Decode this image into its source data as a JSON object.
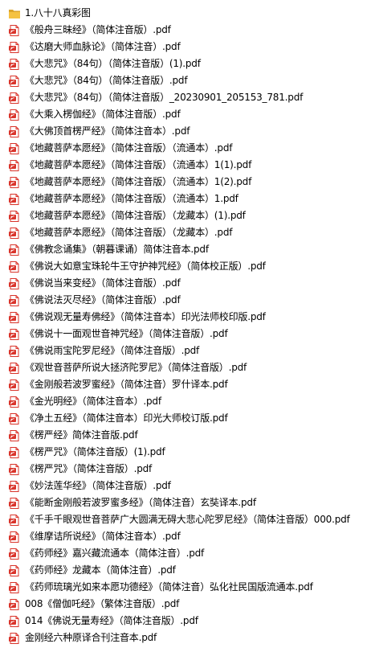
{
  "colors": {
    "pdf_icon_red": "#d9342b",
    "folder_yellow": "#f5c242",
    "folder_dark": "#dca52b",
    "text": "#000000",
    "background": "#ffffff"
  },
  "files": [
    {
      "name": "1.八十八真彩图",
      "icon": "folder-icon"
    },
    {
      "name": "《般舟三昧经》（简体注音版）.pdf",
      "icon": "pdf-icon"
    },
    {
      "name": "《达磨大师血脉论》（简体注音）.pdf",
      "icon": "pdf-icon"
    },
    {
      "name": "《大悲咒》（84句）（简体注音版）(1).pdf",
      "icon": "pdf-icon"
    },
    {
      "name": "《大悲咒》（84句）（简体注音版）.pdf",
      "icon": "pdf-icon"
    },
    {
      "name": "《大悲咒》（84句）（简体注音版）_20230901_205153_781.pdf",
      "icon": "pdf-icon"
    },
    {
      "name": "《大乘入楞伽经》（简体注音版）.pdf",
      "icon": "pdf-icon"
    },
    {
      "name": "《大佛顶首楞严经》（简体注音本）.pdf",
      "icon": "pdf-icon"
    },
    {
      "name": "《地藏菩萨本愿经》（简体注音版）（流通本）.pdf",
      "icon": "pdf-icon"
    },
    {
      "name": "《地藏菩萨本愿经》（简体注音版）（流通本）1(1).pdf",
      "icon": "pdf-icon"
    },
    {
      "name": "《地藏菩萨本愿经》（简体注音版）（流通本）1(2).pdf",
      "icon": "pdf-icon"
    },
    {
      "name": "《地藏菩萨本愿经》（简体注音版）（流通本）1.pdf",
      "icon": "pdf-icon"
    },
    {
      "name": "《地藏菩萨本愿经》（简体注音版）（龙藏本）(1).pdf",
      "icon": "pdf-icon"
    },
    {
      "name": "《地藏菩萨本愿经》（简体注音版）（龙藏本）.pdf",
      "icon": "pdf-icon"
    },
    {
      "name": "《佛教念诵集》（朝暮课诵）简体注音本.pdf",
      "icon": "pdf-icon"
    },
    {
      "name": "《佛说大如意宝珠轮牛王守护神咒经》（简体校正版）.pdf",
      "icon": "pdf-icon"
    },
    {
      "name": "《佛说当来变经》（简体注音版）.pdf",
      "icon": "pdf-icon"
    },
    {
      "name": "《佛说法灭尽经》（简体注音版）.pdf",
      "icon": "pdf-icon"
    },
    {
      "name": "《佛说观无量寿佛经》（简体注音本）印光法师校印版.pdf",
      "icon": "pdf-icon"
    },
    {
      "name": "《佛说十一面观世音神咒经》（简体注音版）.pdf",
      "icon": "pdf-icon"
    },
    {
      "name": "《佛说雨宝陀罗尼经》（简体注音版）.pdf",
      "icon": "pdf-icon"
    },
    {
      "name": "《观世音菩萨所说大拯济陀罗尼》（简体注音版）.pdf",
      "icon": "pdf-icon"
    },
    {
      "name": "《金刚般若波罗蜜经》（简体注音）罗什译本.pdf",
      "icon": "pdf-icon"
    },
    {
      "name": "《金光明经》（简体注音本）.pdf",
      "icon": "pdf-icon"
    },
    {
      "name": "《净土五经》（简体注音本）印光大师校订版.pdf",
      "icon": "pdf-icon"
    },
    {
      "name": "《楞严经》简体注音版.pdf",
      "icon": "pdf-icon"
    },
    {
      "name": "《楞严咒》（简体注音版）(1).pdf",
      "icon": "pdf-icon"
    },
    {
      "name": "《楞严咒》（简体注音版）.pdf",
      "icon": "pdf-icon"
    },
    {
      "name": "《妙法莲华经》（简体注音版）.pdf",
      "icon": "pdf-icon"
    },
    {
      "name": "《能断金刚般若波罗蜜多经》（简体注音）玄奘译本.pdf",
      "icon": "pdf-icon"
    },
    {
      "name": "《千手千眼观世音菩萨广大圆满无碍大悲心陀罗尼经》（简体注音版）000.pdf",
      "icon": "pdf-icon"
    },
    {
      "name": "《维摩诘所说经》（简体注音本）.pdf",
      "icon": "pdf-icon"
    },
    {
      "name": "《药师经》嘉兴藏流通本（简体注音）.pdf",
      "icon": "pdf-icon"
    },
    {
      "name": "《药师经》龙藏本（简体注音）.pdf",
      "icon": "pdf-icon"
    },
    {
      "name": "《药师琉璃光如来本愿功德经》（简体注音）弘化社民国版流通本.pdf",
      "icon": "pdf-icon"
    },
    {
      "name": "008《僧伽吒经》（繁体注音版）.pdf",
      "icon": "pdf-icon"
    },
    {
      "name": "014《佛说无量寿经》（简体注音版）.pdf",
      "icon": "pdf-icon"
    },
    {
      "name": "金刚经六种原译合刊注音本.pdf",
      "icon": "pdf-icon"
    }
  ]
}
